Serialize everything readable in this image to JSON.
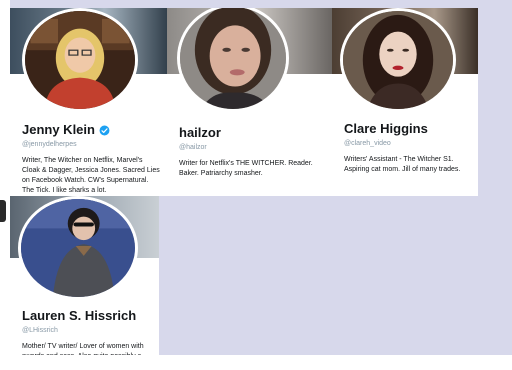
{
  "profiles": [
    {
      "name": "Jenny Klein",
      "handle": "@jennydelherpes",
      "verified": true,
      "bio": "Writer, The Witcher on Netflix, Marvel's Cloak & Dagger, Jessica Jones. Sacred Lies on Facebook Watch. CW's Supernatural. The Tick. I like sharks a lot."
    },
    {
      "name": "hailzor",
      "handle": "@hailzor",
      "verified": false,
      "bio": "Writer for Netflix's THE WITCHER. Reader. Baker. Patriarchy smasher."
    },
    {
      "name": "Clare Higgins",
      "handle": "@clareh_video",
      "verified": false,
      "bio": "Writers' Assistant - The Witcher S1. Aspiring cat mom. Jill of many trades."
    },
    {
      "name": "Lauren S. Hissrich",
      "handle": "@LHissrich",
      "verified": false,
      "bio": "Mother/ TV writer/ Lover of women with swords and sass. Also quite possibly a Witch. Insta: laurenhissrich"
    }
  ],
  "colors": {
    "page_background": "#d7d8eb",
    "card_background": "#ffffff",
    "verified_badge": "#1da1f2",
    "handle_text": "#8899a6",
    "name_text": "#14171a"
  },
  "icons": {
    "verified": "verified-badge-icon"
  }
}
